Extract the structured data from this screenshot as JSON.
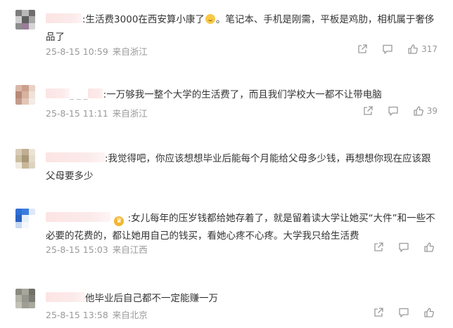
{
  "comments": [
    {
      "name_prefix": "",
      "text": ":生活费3000在西安算小康了",
      "text_after_emoji": "。笔记本、手机是刚需，平板是鸡肋，相机属于奢侈品了",
      "date": "25-8-15 10:59",
      "location": "来自浙江",
      "likes": "317",
      "avatar_colors": [
        "#7d7d7d",
        "#b9b9b9",
        "#6e6e6e",
        "#cfcfcf",
        "#5f5f5f",
        "#a8a8a8",
        "#8d8d8d",
        "#9a7d9a",
        "#d5d5d5"
      ]
    },
    {
      "name_prefix": "_ _ _",
      "text": ":一万够我一整个大学的生活费了，而且我们学校大一都不让带电脑",
      "date": "25-8-15 11:11",
      "location": "来自浙江",
      "likes": "39",
      "avatar_colors": [
        "#d9b8a8",
        "#caa08c",
        "#e8d2c6",
        "#b88a78",
        "#d7b2a0",
        "#efe2da",
        "#c49c8a",
        "#e2c6b8",
        "#f3ebe6"
      ]
    },
    {
      "name_prefix": "",
      "text": ":我觉得吧，你应该想想毕业后能每个月能给父母多少钱，再想想你现在应该跟父母要多少",
      "date": "",
      "location": "",
      "likes": "",
      "avatar_colors": [
        "#d8ccb8",
        "#bfae92",
        "#ebe3d6",
        "#cbbd9f",
        "#a99878",
        "#e4dccb",
        "#f0ebe2",
        "#c8b899",
        "#ddd3c0"
      ]
    },
    {
      "name_prefix": "",
      "text": ":女儿每年的压岁钱都给她存着了，就是留着读大学让她买“大件”和一些不必要的花费的，都让她用自己的钱买，看她心疼不心疼。大学我只给生活费",
      "date": "25-8-15 15:03",
      "location": "来自江西",
      "likes": "",
      "avatar_colors": [
        "#2f6fd6",
        "#3b7be0",
        "#dfe8f7",
        "#2a62c2",
        "#e8eef9",
        "#ffffff",
        "#c9d8f2",
        "#f4f7fc",
        "#ffffff"
      ]
    },
    {
      "name_prefix": "",
      "text": "他毕业后自己都不一定能赚一万",
      "date": "25-8-15 13:58",
      "location": "来自北京",
      "likes": "",
      "avatar_colors": [
        "#8a8a80",
        "#a6a69a",
        "#70706a",
        "#b4b4a8",
        "#96968c",
        "#7c7c74",
        "#c2c2b8",
        "#9e9e94",
        "#a8a89e"
      ]
    }
  ],
  "icons": {
    "share": "share-icon",
    "comment": "comment-icon",
    "like": "thumbs-up-icon",
    "badge": "crown-badge-icon",
    "emoji": "smile-emoji-icon"
  }
}
